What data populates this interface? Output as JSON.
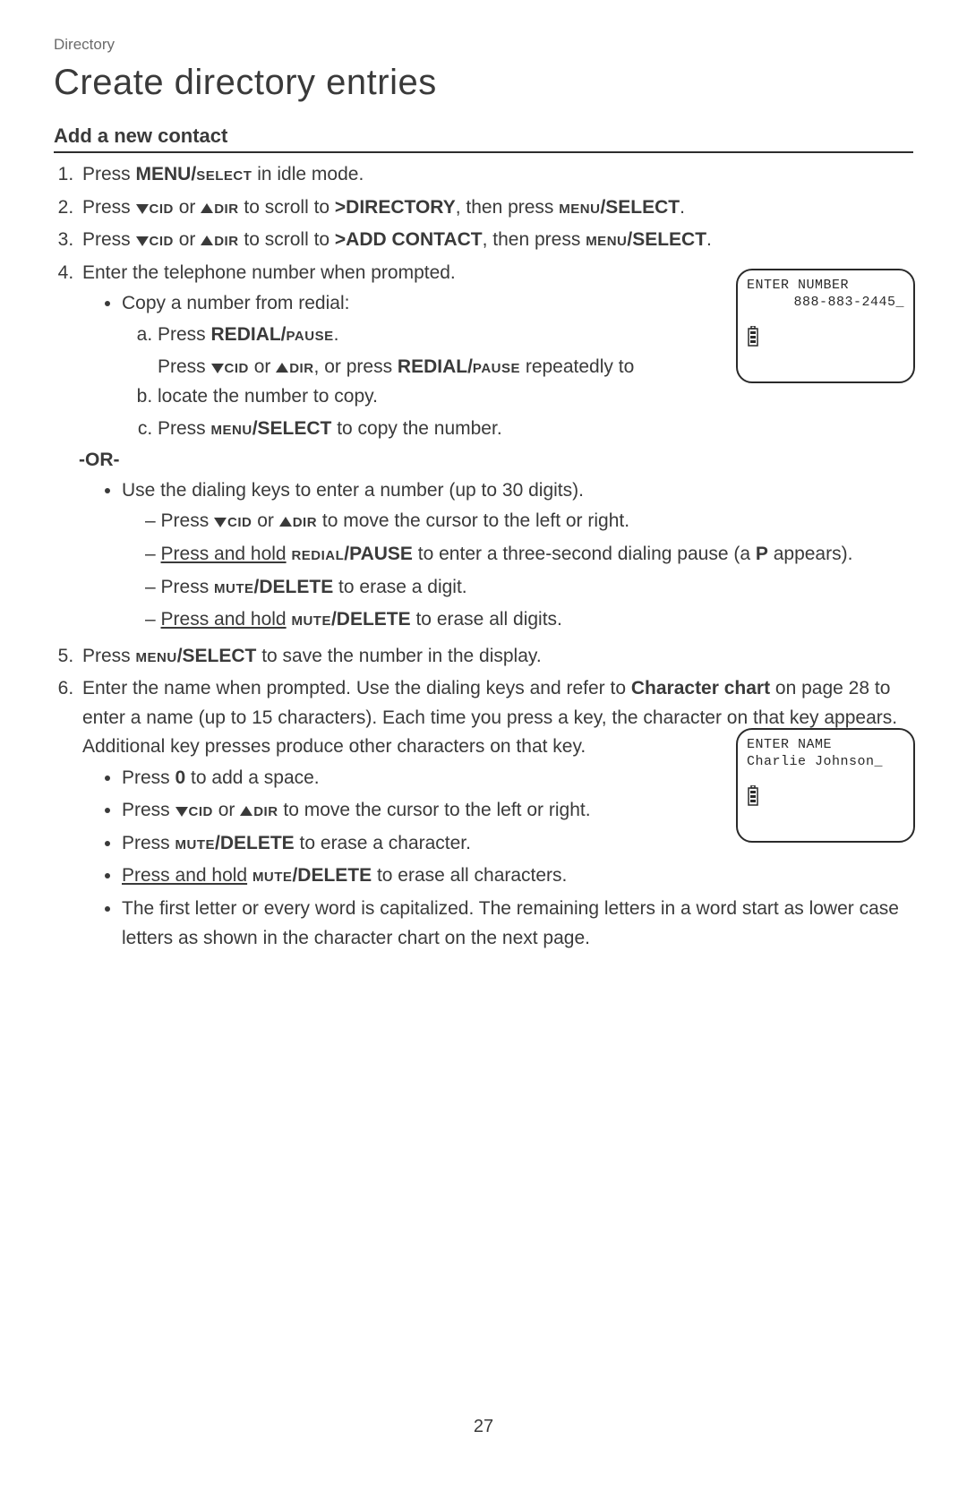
{
  "breadcrumb": "Directory",
  "title": "Create directory entries",
  "section_heading": "Add a new contact",
  "labels": {
    "menu_select_mixed": "MENU/",
    "select_sc": "select",
    "cid": "cid",
    "dir": "dir",
    "directory": ">DIRECTORY",
    "add_contact": ">ADD CONTACT",
    "menu_sc": "menu",
    "select_upper": "/SELECT",
    "redial_pause_mixed": "REDIAL/",
    "pause_sc": "pause",
    "redial_sc": "redial",
    "pause_upper": "/PAUSE",
    "mute_sc": "mute",
    "delete_upper": "/DELETE",
    "zero": "0",
    "p": "P",
    "char_chart": "Character chart"
  },
  "text": {
    "s1_a": "Press ",
    "s1_b": " in idle mode.",
    "s2_a": "Press ",
    "s2_b": " or ",
    "s2_c": " to scroll to ",
    "s2_d": ", then press ",
    "s2_e": ".",
    "s3_a": "Press ",
    "s3_b": " or ",
    "s3_c": " to scroll to ",
    "s3_d": ", then press ",
    "s3_e": ".",
    "s4_intro": "Enter the telephone number when prompted.",
    "s4_copy_intro": "Copy a number from redial:",
    "s4a_a": "Press ",
    "s4a_b": ".",
    "s4b_a": "Press ",
    "s4b_b": " or ",
    "s4b_c": ", or press ",
    "s4b_d": " repeatedly to locate the number to copy.",
    "s4c_a": "Press ",
    "s4c_b": " to copy the number.",
    "or": "-OR-",
    "s4_dial_intro": "Use the dialing keys to enter a number (up to 30 digits).",
    "d1_a": "Press ",
    "d1_b": " or ",
    "d1_c": " to move the cursor to the left or right.",
    "d2_a": "Press and hold",
    "d2_b": " to enter a three-second dialing pause (a ",
    "d2_c": " appears).",
    "d3_a": "Press ",
    "d3_b": " to erase a digit.",
    "d4_a": "Press and hold",
    "d4_b": " to erase all digits.",
    "s5_a": "Press ",
    "s5_b": " to save the number in the display.",
    "s6_intro_a": "Enter the name when prompted. Use the dialing keys and refer to ",
    "s6_intro_b": " on page 28 to enter a name (up to 15 characters). Each time you press a key, the character on that key appears. Additional key presses produce other characters on that key.",
    "n1_a": "Press ",
    "n1_b": " to add a space.",
    "n2_a": "Press ",
    "n2_b": " or ",
    "n2_c": " to move the cursor to the left or right.",
    "n3_a": "Press ",
    "n3_b": " to erase a character.",
    "n4_a": "Press and hold",
    "n4_b": " to erase all characters.",
    "n5": "The first letter or every word is capitalized. The remaining letters in a word start as lower case letters as shown in the character chart on the next page."
  },
  "lcd1": {
    "line1": "ENTER NUMBER",
    "line2": "888-883-2445_"
  },
  "lcd2": {
    "line1": "ENTER NAME",
    "line2": "Charlie Johnson_"
  },
  "page_number": "27"
}
